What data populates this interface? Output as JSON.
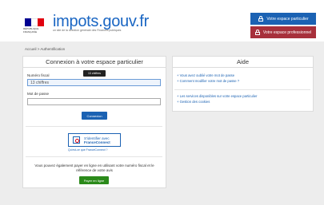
{
  "header": {
    "republic_text": "RÉPUBLIQUE FRANÇAISE",
    "logo_main": "impots",
    "logo_suffix": ".gouv.fr",
    "tagline": "un site de la direction générale des Finances publiques",
    "btn_particulier": "Votre espace particulier",
    "btn_professionnel": "Votre espace professionnel"
  },
  "breadcrumb": "Accueil > Authentification",
  "login": {
    "title": "Connexion à votre espace particulier",
    "fiscal_label": "Numéro fiscal",
    "fiscal_value": "13 chiffres",
    "tooltip": "13 chiffres",
    "password_label": "Mot de passe",
    "password_value": "",
    "connect_button": "Connexion",
    "franceconnect_line1": "S'identifier avec",
    "franceconnect_line2": "FranceConnect",
    "franceconnect_link": "Qu'est-ce que FranceConnect ?",
    "pay_text": "Vous pouvez également payer en ligne en utilisant votre numéro fiscal et le référence de votre avis",
    "pay_button": "Payer en ligne"
  },
  "aide": {
    "title": "Aide",
    "links": [
      "+ Vous avez oublié votre mot de passe",
      "+ Comment modifier votre mot de passe ?",
      "+ Les services disponibles sur votre espace particulier",
      "+ Gestion des cookies"
    ]
  },
  "colors": {
    "brand_blue": "#1b62b3",
    "pro_red": "#a7303b",
    "pay_green": "#2b8a1a"
  }
}
